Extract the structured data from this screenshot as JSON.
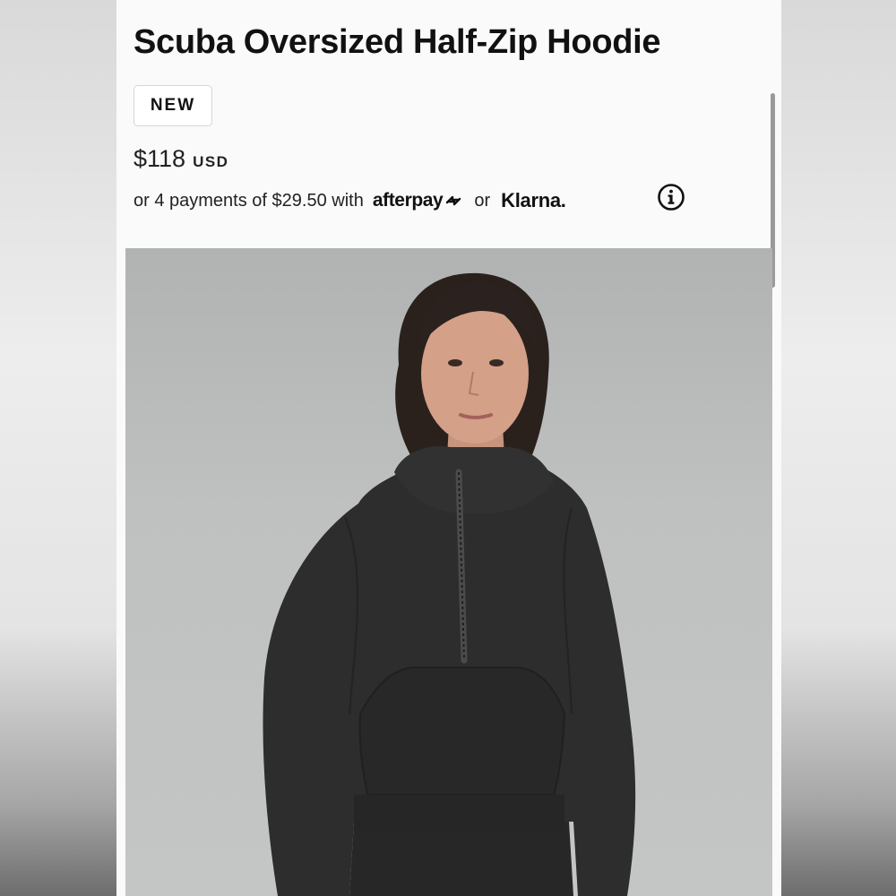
{
  "product": {
    "title": "Scuba Oversized Half-Zip Hoodie",
    "badge": "NEW",
    "price": "$118",
    "currency": "USD"
  },
  "payments": {
    "text": "or 4 payments of $29.50 with",
    "afterpay_label": "afterpay",
    "or_label": "or",
    "klarna_label": "Klarna."
  },
  "icons": {
    "info": "info-icon",
    "afterpay_logo": "afterpay-arrows-icon"
  },
  "colors": {
    "page_bg": "#fafafa",
    "text": "#111111",
    "image_bg": "#bfc1c1",
    "hoodie": "#2c2d2c"
  }
}
